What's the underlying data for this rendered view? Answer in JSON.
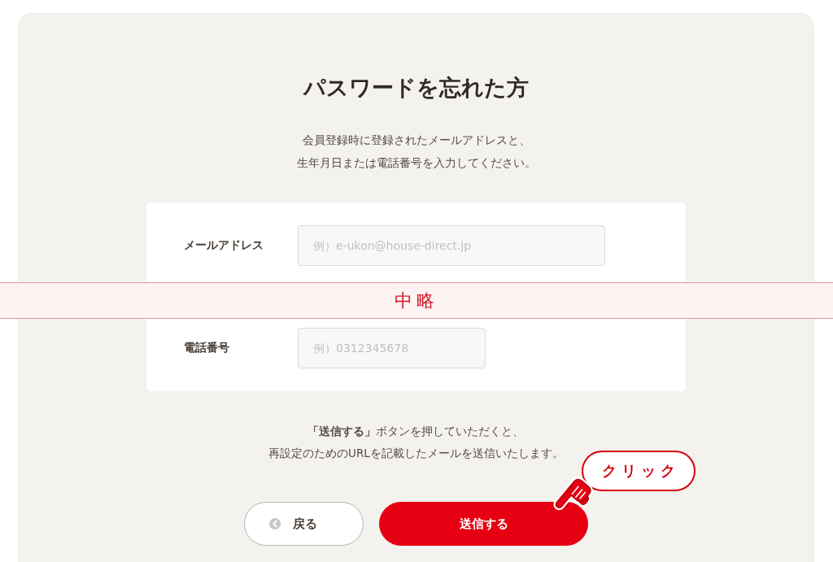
{
  "page": {
    "title": "パスワードを忘れた方",
    "description": [
      "会員登録時に登録されたメールアドレスと、",
      "生年月日または電話番号を入力してください。"
    ]
  },
  "form": {
    "items": [
      {
        "kind": "email",
        "label": "メールアドレス",
        "placeholder": "例）e-ukon@house-direct.jp"
      },
      {
        "kind": "omission",
        "text": "中略"
      },
      {
        "kind": "tel",
        "label": "電話番号",
        "placeholder": "例）0312345678"
      }
    ]
  },
  "notice": [
    "**「送信する」**ボタンを押していただくと、",
    "再設定のためのURLを記載したメールを送信いたします。"
  ],
  "buttons": [
    {
      "kind": "back",
      "label": "戻る"
    },
    {
      "kind": "submit",
      "label": "送信する"
    }
  ],
  "callout": {
    "text": "クリック"
  }
}
